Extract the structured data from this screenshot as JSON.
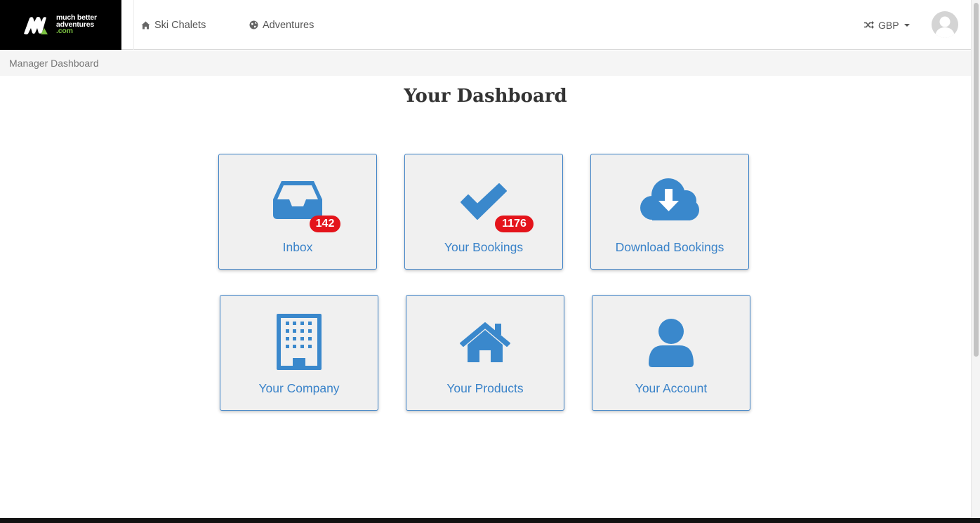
{
  "brand": {
    "line1": "much better",
    "line2": "adventures",
    "line3": ".com"
  },
  "nav": {
    "items": [
      {
        "label": "Ski Chalets",
        "icon": "home-icon"
      },
      {
        "label": "Adventures",
        "icon": "globe-icon"
      }
    ],
    "currency": {
      "label": "GBP",
      "icon": "shuffle-icon"
    },
    "avatar_icon": "user-avatar"
  },
  "breadcrumb": {
    "label": "Manager Dashboard"
  },
  "page": {
    "title": "Your Dashboard"
  },
  "tiles": [
    {
      "label": "Inbox",
      "icon": "inbox-icon",
      "badge": "142"
    },
    {
      "label": "Your Bookings",
      "icon": "checkmark-icon",
      "badge": "1176"
    },
    {
      "label": "Download Bookings",
      "icon": "cloud-download-icon"
    },
    {
      "label": "Your Company",
      "icon": "building-icon"
    },
    {
      "label": "Your Products",
      "icon": "house-icon"
    },
    {
      "label": "Your Account",
      "icon": "user-icon"
    }
  ],
  "colors": {
    "accent": "#3a83c9",
    "icon": "#3a88cc",
    "badge": "#e4141b",
    "brand_green": "#7cc242"
  }
}
